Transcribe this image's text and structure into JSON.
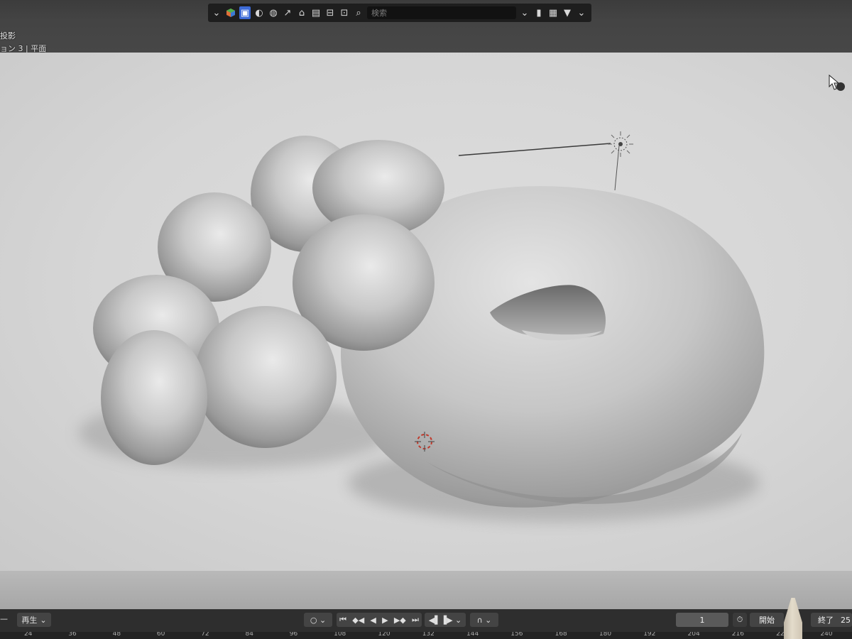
{
  "header": {
    "view_mode": "投影",
    "view_info": "ョン 3 | 平面"
  },
  "toolbar": {
    "icons": [
      "chevron-down-icon",
      "scene-icon",
      "selectable-icon",
      "display-icon",
      "world-icon",
      "cursor-icon",
      "collection-icon",
      "render-icon",
      "filter-icon",
      "link-icon",
      "search-icon"
    ],
    "search_placeholder": "検索",
    "right_icons": [
      "bookmark-icon",
      "layout-icon",
      "funnel-icon"
    ]
  },
  "timeline": {
    "playback_label": "再生",
    "current_frame": "1",
    "start_label": "開始",
    "end_label": "終了",
    "end_value_partial": "25",
    "ruler_ticks": [
      "24",
      "36",
      "48",
      "60",
      "72",
      "84",
      "96",
      "108",
      "120",
      "132",
      "144",
      "156",
      "168",
      "180",
      "192",
      "204",
      "216",
      "228",
      "240"
    ]
  },
  "colors": {
    "viewport_bg": "#d6d6d6",
    "mesh_base": "#bcbcbc",
    "toolbar_bg": "#1e1e1e",
    "selection_blue": "#3d6ad6"
  }
}
